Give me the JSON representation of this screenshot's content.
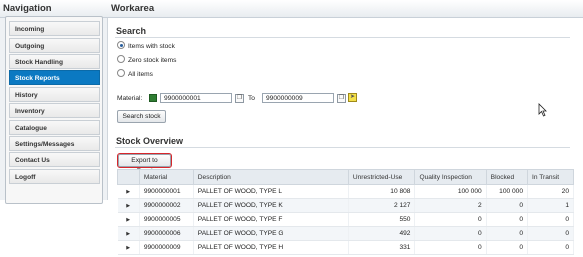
{
  "header": {
    "nav_title": "Navigation",
    "work_title": "Workarea"
  },
  "nav": {
    "items": [
      {
        "label": "Incoming",
        "active": false
      },
      {
        "label": "Outgoing",
        "active": false
      },
      {
        "label": "Stock Handling",
        "active": false
      },
      {
        "label": "Stock Reports",
        "active": true
      },
      {
        "label": "History",
        "active": false
      },
      {
        "label": "Inventory",
        "active": false
      },
      {
        "label": "Catalogue",
        "active": false
      },
      {
        "label": "Settings/Messages",
        "active": false
      },
      {
        "label": "Contact Us",
        "active": false
      },
      {
        "label": "Logoff",
        "active": false
      }
    ]
  },
  "search": {
    "title": "Search",
    "options": [
      "Items with stock",
      "Zero stock items",
      "All items"
    ],
    "selected_option": "Items with stock",
    "material_label": "Material:",
    "from_value": "9900000001",
    "to_label": "To",
    "to_value": "9900000009",
    "button_label": "Search stock"
  },
  "overview": {
    "title": "Stock Overview",
    "export_label": "Export to Excel",
    "columns": [
      "Material",
      "Description",
      "Unrestricted-Use",
      "Quality Inspection",
      "Blocked",
      "In Transit"
    ],
    "rows": [
      [
        "9900000001",
        "PALLET OF WOOD, TYPE L",
        "10 808",
        "100 000",
        "100 000",
        "20"
      ],
      [
        "9900000002",
        "PALLET OF WOOD, TYPE K",
        "2 127",
        "2",
        "0",
        "1"
      ],
      [
        "9900000005",
        "PALLET OF WOOD, TYPE F",
        "550",
        "0",
        "0",
        "0"
      ],
      [
        "9900000006",
        "PALLET OF WOOD, TYPE G",
        "492",
        "0",
        "0",
        "0"
      ],
      [
        "9900000009",
        "PALLET OF WOOD, TYPE H",
        "331",
        "0",
        "0",
        "0"
      ]
    ]
  },
  "colors": {
    "active_nav": "#0b79c2",
    "export_highlight": "#d7262b"
  }
}
